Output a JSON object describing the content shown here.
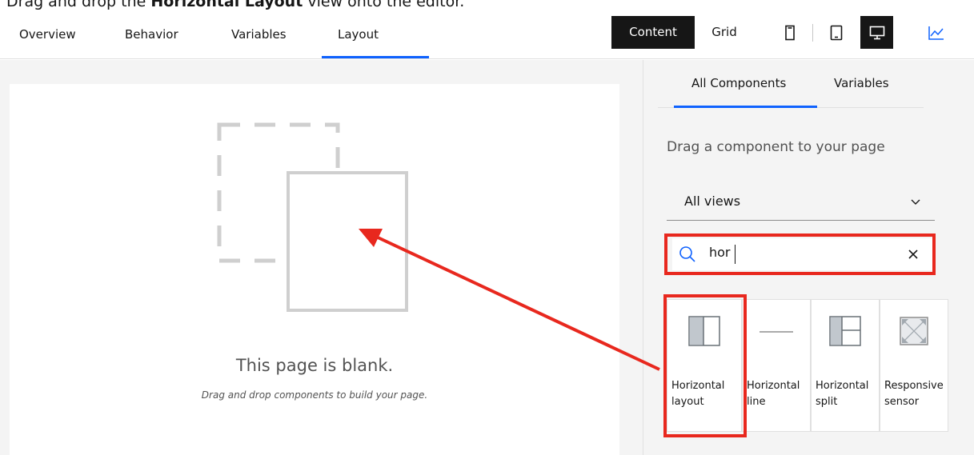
{
  "caption": {
    "prefix": "Drag and drop the ",
    "bold": "Horizontal Layout",
    "suffix": " view onto the editor."
  },
  "top_tabs": [
    {
      "label": "Overview"
    },
    {
      "label": "Behavior"
    },
    {
      "label": "Variables"
    },
    {
      "label": "Layout",
      "active": true
    }
  ],
  "view_toggle": {
    "content_label": "Content",
    "grid_label": "Grid",
    "selected": "Content"
  },
  "device_buttons": {
    "icons": [
      "phone-icon",
      "tablet-icon",
      "desktop-icon"
    ],
    "selected": "desktop-icon"
  },
  "chart_button": {
    "icon": "chart-line-icon"
  },
  "canvas": {
    "blank_title": "This page is blank.",
    "blank_subtitle": "Drag and drop components to build your page."
  },
  "panel": {
    "tabs": [
      {
        "label": "All Components",
        "active": true
      },
      {
        "label": "Variables"
      }
    ],
    "hint": "Drag a component to your page",
    "filter": {
      "selected": "All views"
    },
    "search": {
      "value": "hor"
    },
    "components": [
      {
        "label": "Horizontal\nlayout",
        "icon": "horizontal-layout-icon"
      },
      {
        "label": "Horizontal\nline",
        "icon": "horizontal-line-icon"
      },
      {
        "label": "Horizontal\nsplit",
        "icon": "horizontal-split-icon"
      },
      {
        "label": "Responsive\nsensor",
        "icon": "responsive-sensor-icon"
      }
    ]
  },
  "colors": {
    "accent": "#0f62fe",
    "highlight": "#e8281e",
    "active_bg": "#161616"
  }
}
